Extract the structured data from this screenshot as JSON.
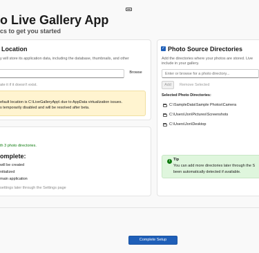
{
  "header": {
    "title": "o Live Gallery App",
    "subtitle": "cs to get you started"
  },
  "data_location": {
    "title": "Location",
    "description": "y will store its application data, including the database, thumbnails, and other",
    "browse_label": "Browse",
    "hint": "ate it if it doesn't exist.",
    "warning_line1": "efault location is C:\\LiveGalleryApp\\ due to AppData virtualization issues.",
    "warning_line2": "s temporarily disabled and will be resolved after beta."
  },
  "summary": {
    "configured": "th 3 photo directories.",
    "heading": "omplete:",
    "items": [
      "will be created",
      "nitialized",
      "main application"
    ],
    "footer": "settings later through the Settings page"
  },
  "photo_sources": {
    "title": "Photo Source Directories",
    "description_line1": "Add the directories where your photos are stored. Live",
    "description_line2": "include in your gallery.",
    "input_placeholder": "Enter or browse for a photo directory...",
    "add_label": "Add",
    "remove_label": "Remove Selected",
    "selected_label": "Selected Photo Directories:",
    "directories": [
      "C:\\SampleData\\Sample Photos\\Camera",
      "C:\\Users\\Jon\\Pictures\\Screenshots",
      "C:\\Users\\Jon\\Desktop"
    ],
    "tip_title": "Tip",
    "tip_line1": "You can add more directories later through the S",
    "tip_line2": "been automatically detected if available."
  },
  "footer": {
    "complete_label": "Complete Setup"
  },
  "colors": {
    "accent": "#1f5fb8",
    "success": "#107c10",
    "warning_bg": "#fff4d0",
    "tip_bg": "#dff6dd"
  }
}
